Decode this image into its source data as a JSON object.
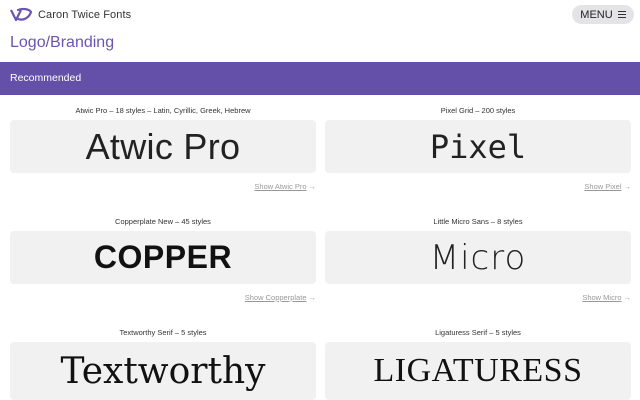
{
  "header": {
    "brand_name": "Caron Twice Fonts",
    "menu_label": "MENU",
    "logo_icon": "ct-logo-icon",
    "menu_icon": "hamburger-icon"
  },
  "page": {
    "title": "Logo/Branding"
  },
  "section": {
    "label": "Recommended",
    "accent_color": "#6550a9"
  },
  "fonts": [
    {
      "meta": "Atwic Pro – 18 styles – Latin, Cyrillic, Greek, Hebrew",
      "sample": "Atwic Pro",
      "link": "Show Atwic Pro"
    },
    {
      "meta": "Pixel Grid – 200 styles",
      "sample": "Pixel",
      "link": "Show Pixel"
    },
    {
      "meta": "Copperplate New – 45 styles",
      "sample": "COPPER",
      "link": "Show Copperplate"
    },
    {
      "meta": "Little Micro Sans – 8 styles",
      "sample": "Micro",
      "link": "Show Micro"
    },
    {
      "meta": "Textworthy Serif – 5 styles",
      "sample": "Textworthy",
      "link": ""
    },
    {
      "meta": "Ligaturess Serif – 5 styles",
      "sample": "LIGATURESS",
      "link": ""
    }
  ],
  "link_arrow": "→"
}
